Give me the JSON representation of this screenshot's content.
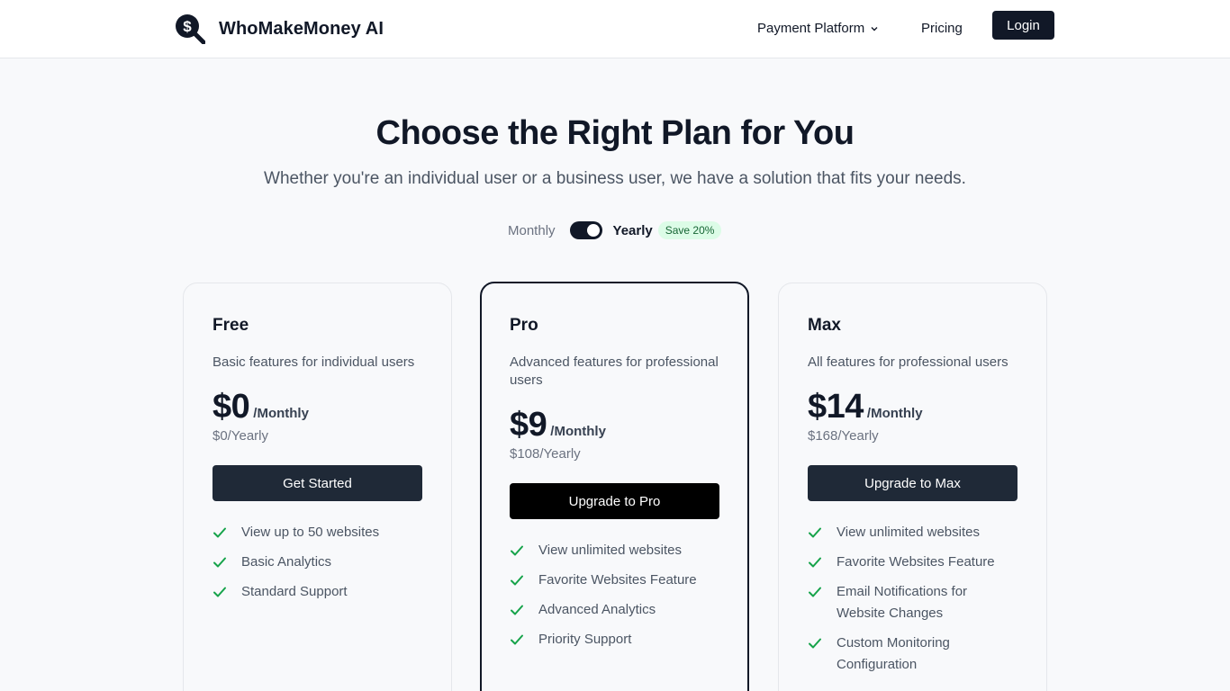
{
  "header": {
    "logo_text": "WhoMakeMoney AI",
    "nav": {
      "platform_label": "Payment Platform",
      "pricing_label": "Pricing"
    },
    "login_label": "Login"
  },
  "hero": {
    "title": "Choose the Right Plan for You",
    "subtitle": "Whether you're an individual user or a business user, we have a solution that fits your needs."
  },
  "billing_toggle": {
    "monthly_label": "Monthly",
    "yearly_label": "Yearly",
    "selected": "Yearly",
    "save_badge": "Save 20%"
  },
  "colors": {
    "accent": "#111827",
    "check": "#16a34a",
    "badge_bg": "#dcfce7",
    "badge_text": "#166534"
  },
  "icons": {
    "logo": "dollar-magnifier-icon",
    "dropdown": "chevron-down-icon",
    "feature": "check-icon"
  },
  "plans": [
    {
      "name": "Free",
      "description": "Basic features for individual users",
      "price": "$0",
      "period": "/Monthly",
      "yearly": "$0/Yearly",
      "cta": "Get Started",
      "features": [
        "View up to 50 websites",
        "Basic Analytics",
        "Standard Support"
      ]
    },
    {
      "name": "Pro",
      "description": "Advanced features for professional users",
      "price": "$9",
      "period": "/Monthly",
      "yearly": "$108/Yearly",
      "cta": "Upgrade to Pro",
      "features": [
        "View unlimited websites",
        "Favorite Websites Feature",
        "Advanced Analytics",
        "Priority Support"
      ]
    },
    {
      "name": "Max",
      "description": "All features for professional users",
      "price": "$14",
      "period": "/Monthly",
      "yearly": "$168/Yearly",
      "cta": "Upgrade to Max",
      "features": [
        "View unlimited websites",
        "Favorite Websites Feature",
        "Email Notifications for Website Changes",
        "Custom Monitoring Configuration"
      ]
    }
  ]
}
